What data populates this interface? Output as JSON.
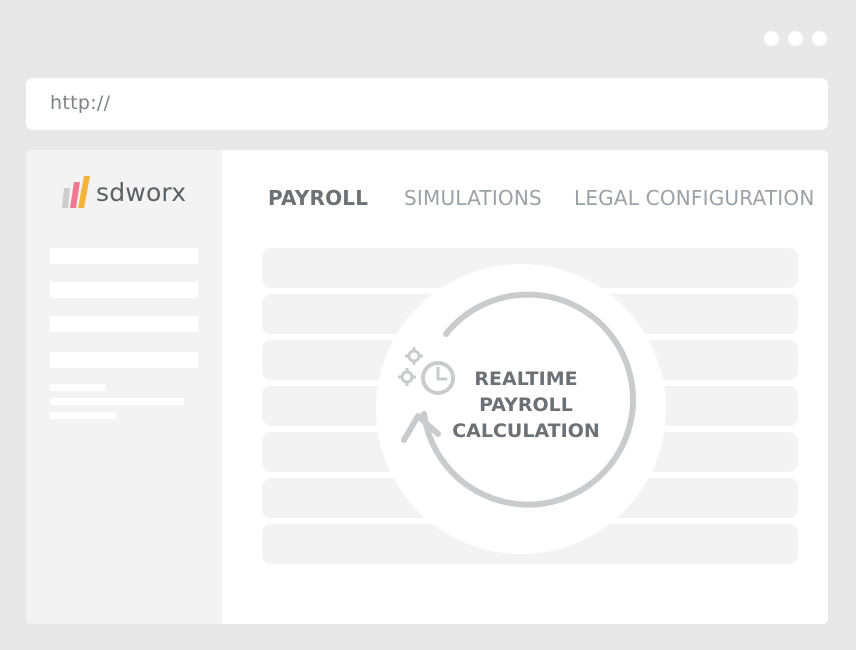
{
  "window": {
    "controls": [
      "dot",
      "dot",
      "dot"
    ]
  },
  "address_bar": {
    "url": "http://"
  },
  "logo": {
    "text": "sdworx",
    "colors": [
      "#cccccc",
      "#f07892",
      "#f4b43a"
    ]
  },
  "tabs": [
    {
      "label": "PAYROLL",
      "active": true
    },
    {
      "label": "SIMULATIONS",
      "active": false
    },
    {
      "label": "LEGAL CONFIGURATION",
      "active": false
    }
  ],
  "badge": {
    "line1": "REALTIME",
    "line2": "PAYROLL",
    "line3": "CALCULATION",
    "icons": [
      "gear-icon",
      "gear-icon",
      "clock-icon",
      "refresh-arrow-icon"
    ]
  },
  "colors": {
    "background": "#e8e8e8",
    "sidebar": "#f3f3f3",
    "placeholder": "#f3f3f3",
    "text_active": "#6c7175",
    "text_inactive": "#9ba1a6",
    "icon": "#c9cccd"
  }
}
